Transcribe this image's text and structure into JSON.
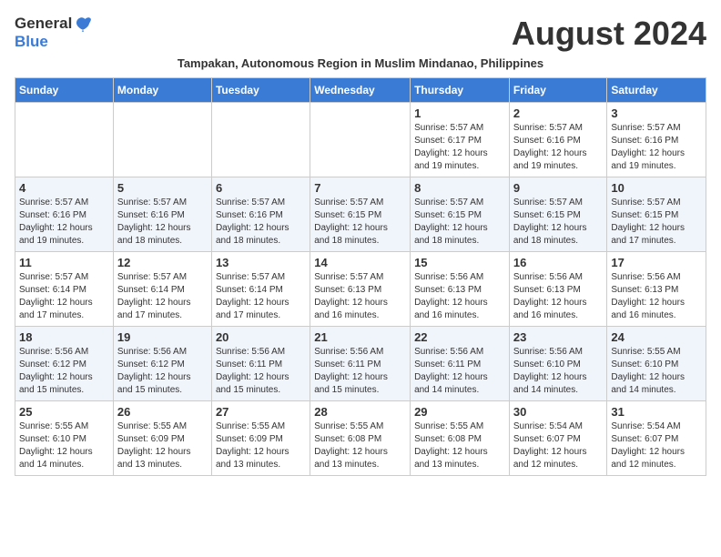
{
  "header": {
    "logo_general": "General",
    "logo_blue": "Blue",
    "month_title": "August 2024",
    "subtitle": "Tampakan, Autonomous Region in Muslim Mindanao, Philippines"
  },
  "weekdays": [
    "Sunday",
    "Monday",
    "Tuesday",
    "Wednesday",
    "Thursday",
    "Friday",
    "Saturday"
  ],
  "weeks": [
    [
      {
        "day": "",
        "info": ""
      },
      {
        "day": "",
        "info": ""
      },
      {
        "day": "",
        "info": ""
      },
      {
        "day": "",
        "info": ""
      },
      {
        "day": "1",
        "info": "Sunrise: 5:57 AM\nSunset: 6:17 PM\nDaylight: 12 hours\nand 19 minutes."
      },
      {
        "day": "2",
        "info": "Sunrise: 5:57 AM\nSunset: 6:16 PM\nDaylight: 12 hours\nand 19 minutes."
      },
      {
        "day": "3",
        "info": "Sunrise: 5:57 AM\nSunset: 6:16 PM\nDaylight: 12 hours\nand 19 minutes."
      }
    ],
    [
      {
        "day": "4",
        "info": "Sunrise: 5:57 AM\nSunset: 6:16 PM\nDaylight: 12 hours\nand 19 minutes."
      },
      {
        "day": "5",
        "info": "Sunrise: 5:57 AM\nSunset: 6:16 PM\nDaylight: 12 hours\nand 18 minutes."
      },
      {
        "day": "6",
        "info": "Sunrise: 5:57 AM\nSunset: 6:16 PM\nDaylight: 12 hours\nand 18 minutes."
      },
      {
        "day": "7",
        "info": "Sunrise: 5:57 AM\nSunset: 6:15 PM\nDaylight: 12 hours\nand 18 minutes."
      },
      {
        "day": "8",
        "info": "Sunrise: 5:57 AM\nSunset: 6:15 PM\nDaylight: 12 hours\nand 18 minutes."
      },
      {
        "day": "9",
        "info": "Sunrise: 5:57 AM\nSunset: 6:15 PM\nDaylight: 12 hours\nand 18 minutes."
      },
      {
        "day": "10",
        "info": "Sunrise: 5:57 AM\nSunset: 6:15 PM\nDaylight: 12 hours\nand 17 minutes."
      }
    ],
    [
      {
        "day": "11",
        "info": "Sunrise: 5:57 AM\nSunset: 6:14 PM\nDaylight: 12 hours\nand 17 minutes."
      },
      {
        "day": "12",
        "info": "Sunrise: 5:57 AM\nSunset: 6:14 PM\nDaylight: 12 hours\nand 17 minutes."
      },
      {
        "day": "13",
        "info": "Sunrise: 5:57 AM\nSunset: 6:14 PM\nDaylight: 12 hours\nand 17 minutes."
      },
      {
        "day": "14",
        "info": "Sunrise: 5:57 AM\nSunset: 6:13 PM\nDaylight: 12 hours\nand 16 minutes."
      },
      {
        "day": "15",
        "info": "Sunrise: 5:56 AM\nSunset: 6:13 PM\nDaylight: 12 hours\nand 16 minutes."
      },
      {
        "day": "16",
        "info": "Sunrise: 5:56 AM\nSunset: 6:13 PM\nDaylight: 12 hours\nand 16 minutes."
      },
      {
        "day": "17",
        "info": "Sunrise: 5:56 AM\nSunset: 6:13 PM\nDaylight: 12 hours\nand 16 minutes."
      }
    ],
    [
      {
        "day": "18",
        "info": "Sunrise: 5:56 AM\nSunset: 6:12 PM\nDaylight: 12 hours\nand 15 minutes."
      },
      {
        "day": "19",
        "info": "Sunrise: 5:56 AM\nSunset: 6:12 PM\nDaylight: 12 hours\nand 15 minutes."
      },
      {
        "day": "20",
        "info": "Sunrise: 5:56 AM\nSunset: 6:11 PM\nDaylight: 12 hours\nand 15 minutes."
      },
      {
        "day": "21",
        "info": "Sunrise: 5:56 AM\nSunset: 6:11 PM\nDaylight: 12 hours\nand 15 minutes."
      },
      {
        "day": "22",
        "info": "Sunrise: 5:56 AM\nSunset: 6:11 PM\nDaylight: 12 hours\nand 14 minutes."
      },
      {
        "day": "23",
        "info": "Sunrise: 5:56 AM\nSunset: 6:10 PM\nDaylight: 12 hours\nand 14 minutes."
      },
      {
        "day": "24",
        "info": "Sunrise: 5:55 AM\nSunset: 6:10 PM\nDaylight: 12 hours\nand 14 minutes."
      }
    ],
    [
      {
        "day": "25",
        "info": "Sunrise: 5:55 AM\nSunset: 6:10 PM\nDaylight: 12 hours\nand 14 minutes."
      },
      {
        "day": "26",
        "info": "Sunrise: 5:55 AM\nSunset: 6:09 PM\nDaylight: 12 hours\nand 13 minutes."
      },
      {
        "day": "27",
        "info": "Sunrise: 5:55 AM\nSunset: 6:09 PM\nDaylight: 12 hours\nand 13 minutes."
      },
      {
        "day": "28",
        "info": "Sunrise: 5:55 AM\nSunset: 6:08 PM\nDaylight: 12 hours\nand 13 minutes."
      },
      {
        "day": "29",
        "info": "Sunrise: 5:55 AM\nSunset: 6:08 PM\nDaylight: 12 hours\nand 13 minutes."
      },
      {
        "day": "30",
        "info": "Sunrise: 5:54 AM\nSunset: 6:07 PM\nDaylight: 12 hours\nand 12 minutes."
      },
      {
        "day": "31",
        "info": "Sunrise: 5:54 AM\nSunset: 6:07 PM\nDaylight: 12 hours\nand 12 minutes."
      }
    ]
  ]
}
